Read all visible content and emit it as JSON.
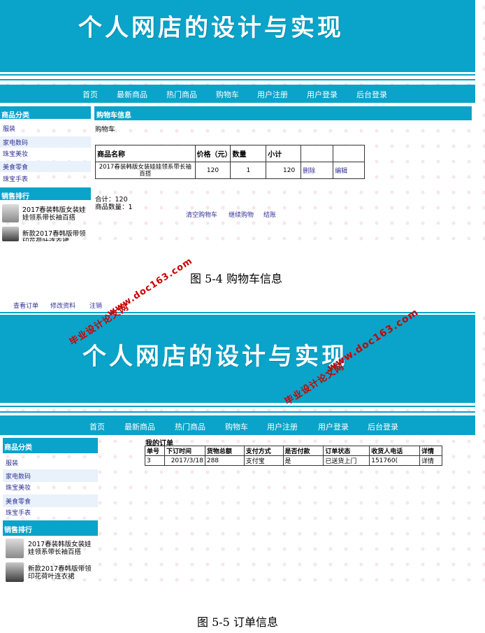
{
  "site_title": "个人网店的设计与实现",
  "nav": [
    "首页",
    "最新商品",
    "热门商品",
    "购物车",
    "用户注册",
    "用户登录",
    "后台登录"
  ],
  "sidebar": {
    "category_head": "商品分类",
    "categories": [
      "服装",
      "家电数码",
      "珠宝美妆",
      "美食零食",
      "珠宝手表"
    ],
    "rank_head": "销售排行",
    "products": [
      "2017春装韩版女装娃娃领系带长袖百搭",
      "新款2017春韩版带领印花荷叶连衣裙"
    ],
    "products_first_crop": [
      "2017春装韩版女装娃娃领系带长袖百搭",
      "新款2017春韩版带领印花荷叶连衣裙"
    ]
  },
  "cart": {
    "head": "购物车信息",
    "sub": "购物车",
    "columns": [
      "商品名称",
      "价格（元）",
      "数量",
      "小计",
      "",
      ""
    ],
    "row": {
      "name": "2017春装韩版女装娃娃领系带长袖百搭",
      "price": "120",
      "qty": "1",
      "subtotal": "120",
      "delete": "删除",
      "edit": "编辑"
    },
    "total": "合计：120",
    "count": "商品数量：1",
    "actions": [
      "清空购物车",
      "继续购物",
      "结账"
    ]
  },
  "captions": {
    "first": "图 5-4 购物车信息",
    "second": "图 5-5 订单信息"
  },
  "user_links": [
    "查看订单",
    "修改资料",
    "注销"
  ],
  "orders": {
    "head": "我的订单",
    "columns": [
      "单号",
      "下订时间",
      "货物总额",
      "支付方式",
      "是否付款",
      "订单状态",
      "收货人电话",
      "详情"
    ],
    "row": [
      "3",
      "2017/3/18",
      "288",
      "支付宝",
      "是",
      "已送货上门",
      "151760(",
      "详情"
    ]
  },
  "watermarks": [
    "www.doc163.com",
    "毕业设计论文网"
  ],
  "colors": {
    "accent": "#0aa3c9",
    "link": "#333399",
    "watermark": "#cc0000"
  }
}
